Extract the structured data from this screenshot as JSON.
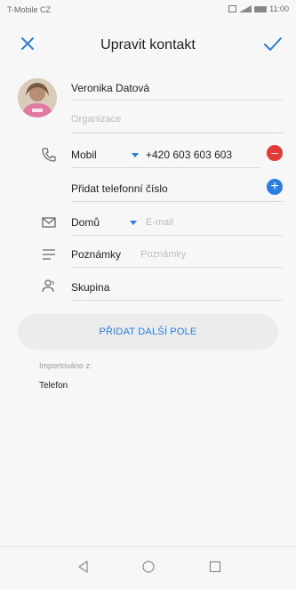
{
  "status_bar": {
    "carrier": "T-Mobile CZ",
    "time": "11:00"
  },
  "app_bar": {
    "title": "Upravit kontakt",
    "close_icon": "close-icon",
    "save_icon": "check-icon"
  },
  "contact": {
    "name": "Veronika Datová",
    "organization_placeholder": "Organizace"
  },
  "phone": {
    "type": "Mobil",
    "value": "+420 603 603 603",
    "add_label": "Přidat telefonní číslo"
  },
  "email": {
    "type": "Domů",
    "placeholder": "E-mail"
  },
  "notes": {
    "label": "Poznámky",
    "placeholder": "Poznámky"
  },
  "group": {
    "label": "Skupina"
  },
  "add_field_label": "PŘIDAT DALŠÍ POLE",
  "imported": {
    "label": "Importováno z:",
    "value": "Telefon"
  },
  "colors": {
    "accent": "#2a7de1",
    "danger": "#e53935"
  }
}
